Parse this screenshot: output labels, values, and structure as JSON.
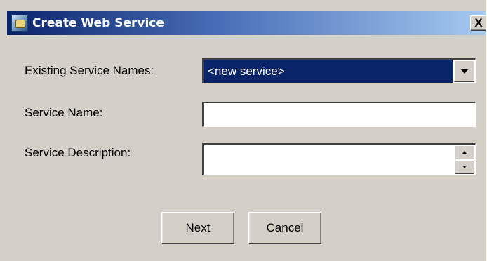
{
  "window": {
    "title": "Create Web Service",
    "close_label": "X"
  },
  "form": {
    "existing_label": "Existing Service Names:",
    "existing_selected": "<new service>",
    "name_label": "Service Name:",
    "name_value": "",
    "desc_label": "Service Description:",
    "desc_value": ""
  },
  "buttons": {
    "next_label": "Next",
    "cancel_label": "Cancel"
  },
  "colors": {
    "title_gradient_start": "#0a246a",
    "title_gradient_end": "#a6caf0",
    "dialog_face": "#d4d0c8",
    "selection": "#0a246a"
  },
  "icons": [
    "web-service-app-icon",
    "close-icon",
    "chevron-down-icon",
    "spin-up-icon",
    "spin-down-icon"
  ]
}
